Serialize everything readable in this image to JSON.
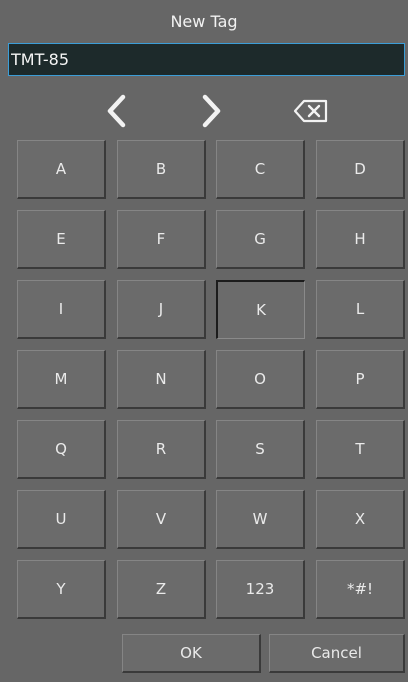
{
  "dialog": {
    "title": "New Tag",
    "input_value": "TMT-85",
    "accent_color": "#3c9ed8"
  },
  "nav": {
    "prev_icon": "chevron-left-icon",
    "next_icon": "chevron-right-icon",
    "backspace_icon": "backspace-icon"
  },
  "keys": [
    [
      "A",
      "B",
      "C",
      "D"
    ],
    [
      "E",
      "F",
      "G",
      "H"
    ],
    [
      "I",
      "J",
      "K",
      "L"
    ],
    [
      "M",
      "N",
      "O",
      "P"
    ],
    [
      "Q",
      "R",
      "S",
      "T"
    ],
    [
      "U",
      "V",
      "W",
      "X"
    ],
    [
      "Y",
      "Z",
      "123",
      "*#!"
    ]
  ],
  "pressed_key": "K",
  "actions": {
    "ok_label": "OK",
    "cancel_label": "Cancel"
  }
}
